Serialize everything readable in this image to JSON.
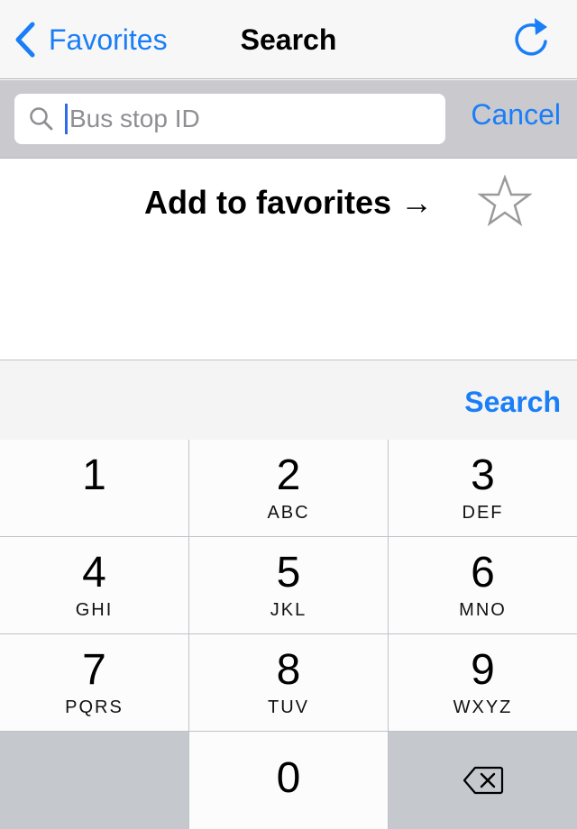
{
  "navbar": {
    "back_label": "Favorites",
    "title": "Search",
    "refresh_icon": "refresh-icon"
  },
  "search": {
    "placeholder": "Bus stop ID",
    "value": "",
    "cancel_label": "Cancel"
  },
  "content": {
    "hint": "Add to favorites →",
    "star_icon": "star-outline-icon"
  },
  "accessory": {
    "search_label": "Search"
  },
  "keypad": {
    "keys": [
      {
        "digit": "1",
        "letters": ""
      },
      {
        "digit": "2",
        "letters": "ABC"
      },
      {
        "digit": "3",
        "letters": "DEF"
      },
      {
        "digit": "4",
        "letters": "GHI"
      },
      {
        "digit": "5",
        "letters": "JKL"
      },
      {
        "digit": "6",
        "letters": "MNO"
      },
      {
        "digit": "7",
        "letters": "PQRS"
      },
      {
        "digit": "8",
        "letters": "TUV"
      },
      {
        "digit": "9",
        "letters": "WXYZ"
      },
      {
        "digit": "0",
        "letters": ""
      }
    ],
    "delete_icon": "backspace-icon"
  },
  "colors": {
    "accent": "#1a7ef7",
    "searchbar_bg": "#c9c9ce",
    "key_bg": "#fcfcfc",
    "key_dark_bg": "#c5c8cc"
  }
}
